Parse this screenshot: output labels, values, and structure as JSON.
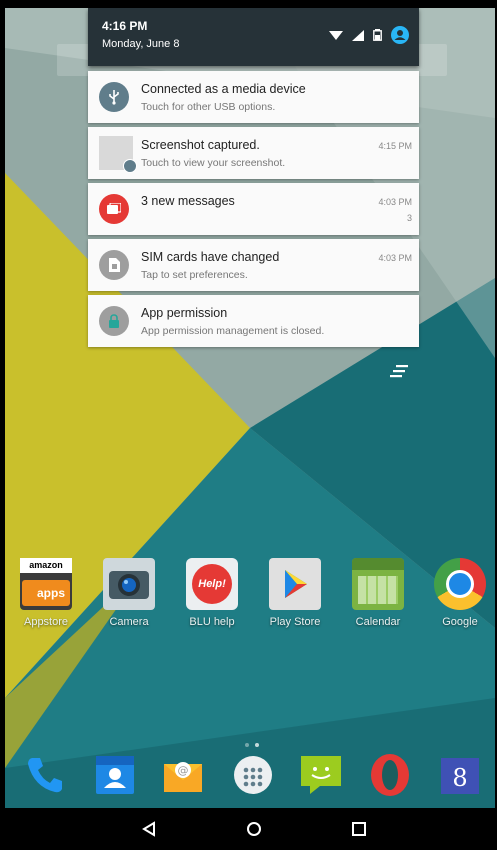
{
  "status_bar": {
    "time": "4:16 PM",
    "date": "Monday, June 8",
    "icons": [
      "wifi-icon",
      "signal-icon",
      "battery-icon",
      "account-icon"
    ]
  },
  "notifications": [
    {
      "title": "Connected as a media device",
      "subtitle": "Touch for other USB options.",
      "time": "",
      "count": "",
      "icon": "usb-icon",
      "color": "#607d8b"
    },
    {
      "title": "Screenshot captured.",
      "subtitle": "Touch to view your screenshot.",
      "time": "4:15 PM",
      "count": "",
      "icon": "screenshot-thumbnail-icon",
      "color": "#d6d6d6"
    },
    {
      "title": "3 new messages",
      "subtitle": "",
      "time": "4:03 PM",
      "count": "3",
      "icon": "messages-icon",
      "color": "#e53935"
    },
    {
      "title": "SIM cards have changed",
      "subtitle": "Tap to set preferences.",
      "time": "4:03 PM",
      "count": "",
      "icon": "sim-card-icon",
      "color": "#9e9e9e"
    },
    {
      "title": "App permission",
      "subtitle": "App permission management is closed.",
      "time": "",
      "count": "",
      "icon": "lock-icon",
      "color": "#9e9e9e"
    }
  ],
  "apps": [
    {
      "label": "Appstore",
      "icon": "amazon-appstore-icon",
      "icon_text_top": "amazon",
      "icon_text_bottom": "apps"
    },
    {
      "label": "Camera",
      "icon": "camera-icon"
    },
    {
      "label": "BLU help",
      "icon": "blu-help-icon",
      "icon_text": "Help!"
    },
    {
      "label": "Play Store",
      "icon": "play-store-icon"
    },
    {
      "label": "Calendar",
      "icon": "calendar-icon"
    },
    {
      "label": "Google",
      "icon": "chrome-icon"
    }
  ],
  "dock": [
    "phone-icon",
    "contacts-icon",
    "email-icon",
    "app-drawer-icon",
    "messaging-icon",
    "opera-icon",
    "google-plus-icon"
  ],
  "dock_text": {
    "google_plus": "8"
  },
  "nav": [
    "back-icon",
    "home-icon",
    "recents-icon"
  ],
  "colors": {
    "teal": "#1f7f86",
    "dark_teal": "#145a61",
    "olive": "#c8bf2d",
    "grey_green": "#9fb3ae",
    "shade_header": "#263238"
  }
}
